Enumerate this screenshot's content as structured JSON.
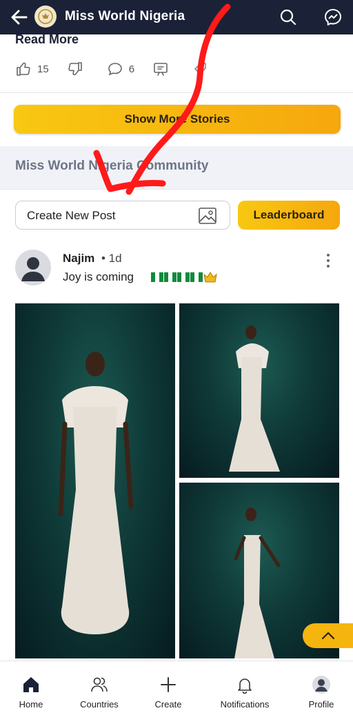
{
  "header": {
    "title": "Miss World Nigeria",
    "back_icon": "arrow-left-icon",
    "search_icon": "search-icon",
    "messenger_icon": "messenger-icon"
  },
  "story": {
    "read_more": "Read More",
    "likes": "15",
    "comments": "6"
  },
  "show_more": "Show More Stories",
  "community": {
    "title": "Miss World Nigeria Community",
    "create_post_placeholder": "Create New Post",
    "leaderboard": "Leaderboard"
  },
  "post": {
    "author": "Najim",
    "time": "• 1d",
    "text": "Joy is coming",
    "emojis": [
      "nigeria-flag",
      "nigeria-flag",
      "nigeria-flag",
      "nigeria-flag",
      "crown"
    ]
  },
  "bottom_nav": [
    {
      "label": "Home",
      "icon": "home-icon",
      "active": true
    },
    {
      "label": "Countries",
      "icon": "users-icon"
    },
    {
      "label": "Create",
      "icon": "plus-icon"
    },
    {
      "label": "Notifications",
      "icon": "bell-icon"
    },
    {
      "label": "Profile",
      "icon": "avatar-icon"
    }
  ],
  "colors": {
    "header_bg": "#1b2237",
    "accent_yellow": "#f8c812",
    "annotation_red": "#ff1a1a"
  }
}
